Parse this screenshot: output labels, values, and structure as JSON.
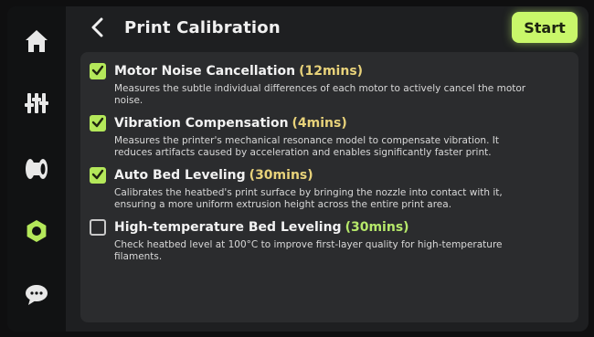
{
  "header": {
    "title": "Print Calibration",
    "start_label": "Start"
  },
  "sidebar": {
    "items": [
      {
        "icon": "home-icon",
        "active": false
      },
      {
        "icon": "tools-icon",
        "active": false
      },
      {
        "icon": "filament-icon",
        "active": false
      },
      {
        "icon": "settings-nut-icon",
        "active": true
      },
      {
        "icon": "chat-icon",
        "active": false
      }
    ]
  },
  "options": [
    {
      "checked": true,
      "title": "Motor Noise Cancellation",
      "duration": "(12mins)",
      "description": "Measures the subtle individual differences of each motor to actively cancel the motor noise."
    },
    {
      "checked": true,
      "title": "Vibration Compensation",
      "duration": "(4mins)",
      "description": "Measures the printer's mechanical resonance model to compensate vibration. It reduces artifacts caused by acceleration and enables significantly faster print."
    },
    {
      "checked": true,
      "title": "Auto Bed Leveling",
      "duration": "(30mins)",
      "description": "Calibrates the heatbed's print surface by bringing the nozzle into contact with it, ensuring a more uniform extrusion height across the entire print area."
    },
    {
      "checked": false,
      "title": "High-temperature Bed Leveling",
      "duration": "(30mins)",
      "description": "Check heatbed level at 100°C to improve first-layer quality for high-temperature filaments."
    }
  ],
  "colors": {
    "accent": "#c9f76a",
    "checkbox_checked": "#b4e85a",
    "duration_checked": "#e8d27a",
    "duration_unchecked": "#b6e86a"
  }
}
